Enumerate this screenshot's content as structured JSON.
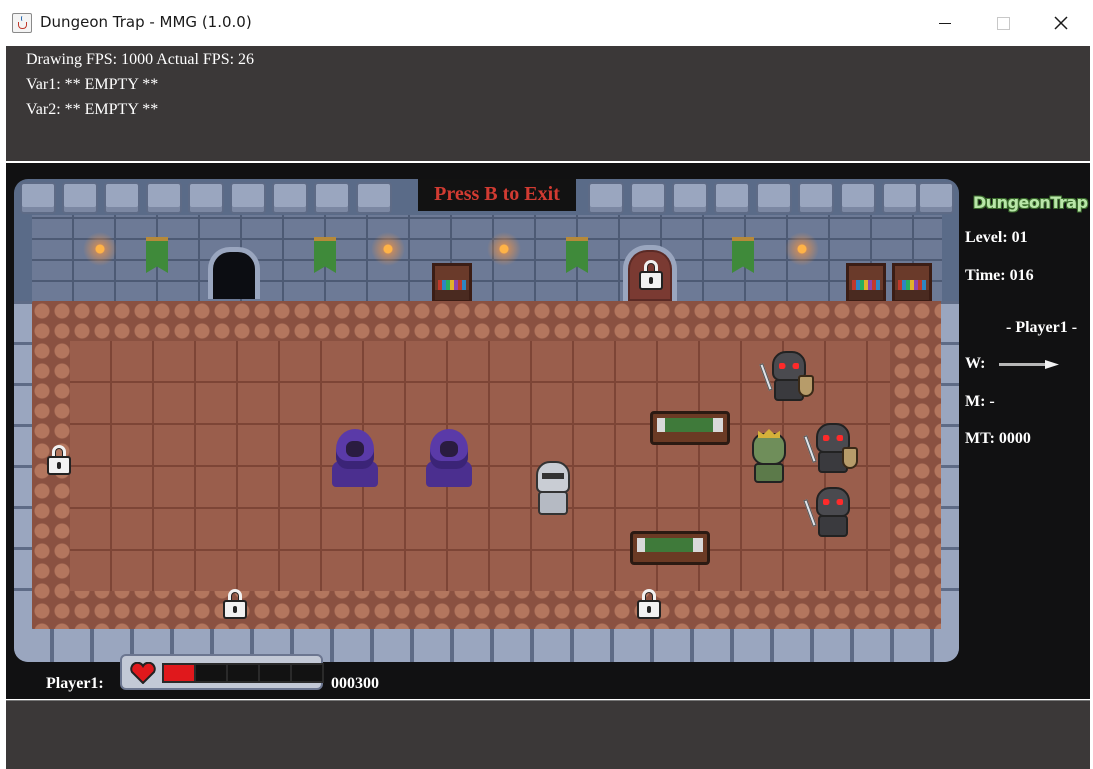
{
  "window": {
    "title": "Dungeon Trap - MMG (1.0.0)",
    "icon": "java-cup-icon",
    "controls": [
      "minimize",
      "maximize",
      "close"
    ]
  },
  "debug": {
    "line1": "Drawing FPS: 1000 Actual FPS: 26",
    "line2": "Var1: ** EMPTY **",
    "line3": "Var2: ** EMPTY **"
  },
  "game": {
    "exit_prompt": "Press B to Exit",
    "logo": "DungeonTrap",
    "level": "Level: 01",
    "time": "Time: 016",
    "player_header": "- Player1 -",
    "weapon_label": "W:",
    "weapon_icon": "arrow-icon",
    "magic_label": "M: -",
    "magic_timer": "MT: 0000",
    "player_label": "Player1:",
    "score": "000300",
    "health": {
      "filled": 1,
      "total": 5
    },
    "colors": {
      "exit_text": "#d23b32",
      "health_fill": "#e0181c",
      "logo": "#b9e6a9"
    }
  }
}
